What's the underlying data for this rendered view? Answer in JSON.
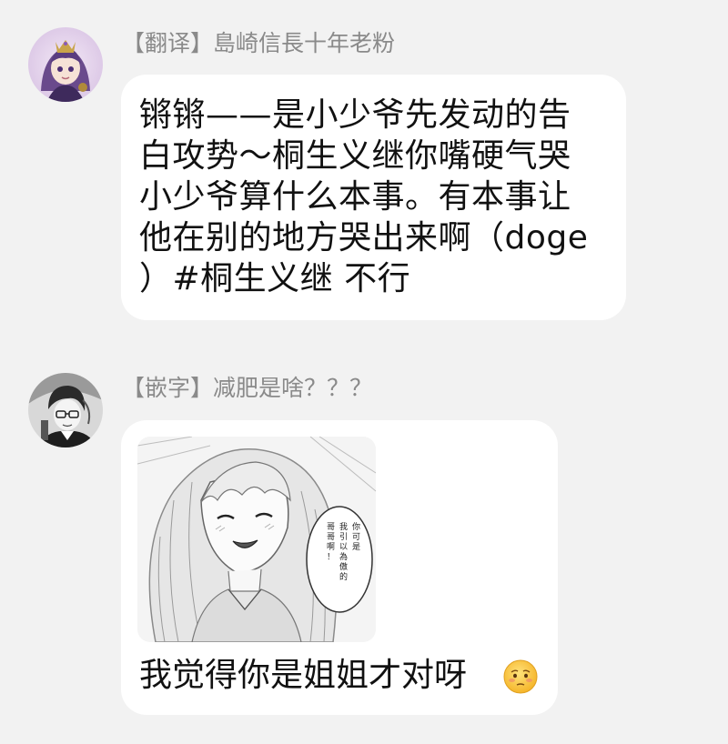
{
  "messages": [
    {
      "sender_tag": "【翻译】",
      "sender_name": "島崎信長十年老粉",
      "text_lines": [
        "锵锵——是小少爷先发动的告",
        "白攻势～桐生义继你嘴硬气哭",
        "小少爷算什么本事。有本事让",
        "他在别的地方哭出来啊（doge",
        "）#桐生义继 不行"
      ]
    },
    {
      "sender_tag": "【嵌字】",
      "sender_name": "减肥是啥？？？",
      "image_speech": [
        "你可是",
        "我引以為傲的",
        "哥哥啊！"
      ],
      "caption": "我觉得你是姐姐才对呀",
      "emoji": "flushed-face"
    }
  ],
  "colors": {
    "background": "#f2f2f2",
    "bubble": "#ffffff",
    "sender": "#8a8a8a",
    "text": "#111111"
  }
}
